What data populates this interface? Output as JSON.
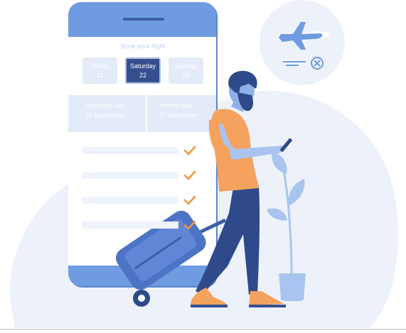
{
  "booking": {
    "title": "Book your flight",
    "days": [
      {
        "weekday": "Friday",
        "day": "21",
        "selected": false
      },
      {
        "weekday": "Saturday",
        "day": "22",
        "selected": true
      },
      {
        "weekday": "Sunday",
        "day": "23",
        "selected": false
      }
    ],
    "departing_label": "Departing date",
    "departing_value": "25 September",
    "arriving_label": "Arriving date",
    "arriving_value": "27 September",
    "checklist_rows": 4
  },
  "icons": [
    "airplane-icon",
    "close-circle-icon",
    "check-icon"
  ],
  "colors": {
    "phone_blue": "#6f9be0",
    "accent_navy": "#34508f",
    "blob_bg": "#edf2fa",
    "check_orange": "#f2963b",
    "shirt_orange": "#f4a25e",
    "pants_navy": "#2f4a8a"
  }
}
